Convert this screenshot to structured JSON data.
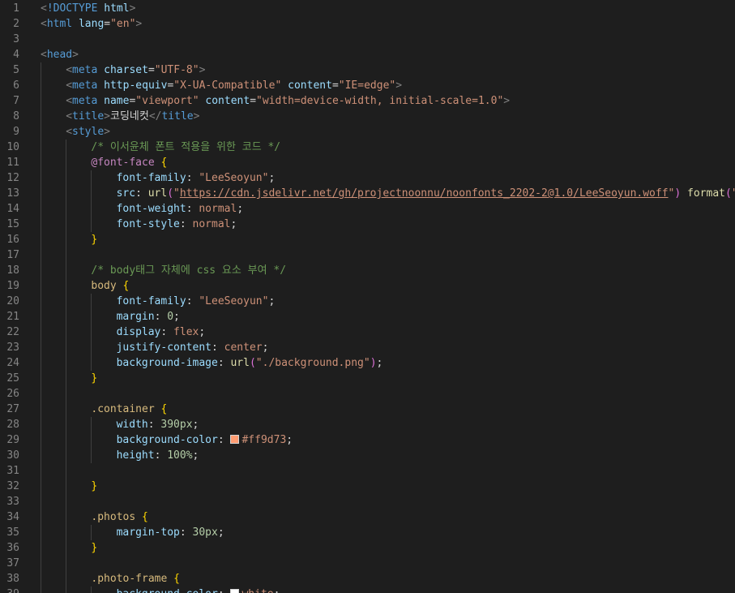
{
  "editor": {
    "lines": [
      {
        "n": "1",
        "indent": 0,
        "tokens": [
          [
            "br",
            "<"
          ],
          [
            "tag",
            "!DOCTYPE"
          ],
          [
            "txt",
            " "
          ],
          [
            "attr",
            "html"
          ],
          [
            "br",
            ">"
          ]
        ]
      },
      {
        "n": "2",
        "indent": 0,
        "tokens": [
          [
            "br",
            "<"
          ],
          [
            "tag",
            "html"
          ],
          [
            "txt",
            " "
          ],
          [
            "attr",
            "lang"
          ],
          [
            "txt",
            "="
          ],
          [
            "str",
            "\"en\""
          ],
          [
            "br",
            ">"
          ]
        ]
      },
      {
        "n": "3",
        "indent": 0,
        "tokens": []
      },
      {
        "n": "4",
        "indent": 0,
        "tokens": [
          [
            "br",
            "<"
          ],
          [
            "tag",
            "head"
          ],
          [
            "br",
            ">"
          ]
        ]
      },
      {
        "n": "5",
        "indent": 1,
        "tokens": [
          [
            "br",
            "<"
          ],
          [
            "tag",
            "meta"
          ],
          [
            "txt",
            " "
          ],
          [
            "attr",
            "charset"
          ],
          [
            "txt",
            "="
          ],
          [
            "str",
            "\"UTF-8\""
          ],
          [
            "br",
            ">"
          ]
        ]
      },
      {
        "n": "6",
        "indent": 1,
        "tokens": [
          [
            "br",
            "<"
          ],
          [
            "tag",
            "meta"
          ],
          [
            "txt",
            " "
          ],
          [
            "attr",
            "http-equiv"
          ],
          [
            "txt",
            "="
          ],
          [
            "str",
            "\"X-UA-Compatible\""
          ],
          [
            "txt",
            " "
          ],
          [
            "attr",
            "content"
          ],
          [
            "txt",
            "="
          ],
          [
            "str",
            "\"IE=edge\""
          ],
          [
            "br",
            ">"
          ]
        ]
      },
      {
        "n": "7",
        "indent": 1,
        "tokens": [
          [
            "br",
            "<"
          ],
          [
            "tag",
            "meta"
          ],
          [
            "txt",
            " "
          ],
          [
            "attr",
            "name"
          ],
          [
            "txt",
            "="
          ],
          [
            "str",
            "\"viewport\""
          ],
          [
            "txt",
            " "
          ],
          [
            "attr",
            "content"
          ],
          [
            "txt",
            "="
          ],
          [
            "str",
            "\"width=device-width, initial-scale=1.0\""
          ],
          [
            "br",
            ">"
          ]
        ]
      },
      {
        "n": "8",
        "indent": 1,
        "tokens": [
          [
            "br",
            "<"
          ],
          [
            "tag",
            "title"
          ],
          [
            "br",
            ">"
          ],
          [
            "txt",
            "코딩네컷"
          ],
          [
            "br",
            "</"
          ],
          [
            "tag",
            "title"
          ],
          [
            "br",
            ">"
          ]
        ]
      },
      {
        "n": "9",
        "indent": 1,
        "tokens": [
          [
            "br",
            "<"
          ],
          [
            "tag",
            "style"
          ],
          [
            "br",
            ">"
          ]
        ]
      },
      {
        "n": "10",
        "indent": 2,
        "tokens": [
          [
            "cmt",
            "/* 이서윤체 폰트 적용을 위한 코드 */"
          ]
        ]
      },
      {
        "n": "11",
        "indent": 2,
        "tokens": [
          [
            "at",
            "@font-face"
          ],
          [
            "txt",
            " "
          ],
          [
            "brace1",
            "{"
          ]
        ]
      },
      {
        "n": "12",
        "indent": 3,
        "tokens": [
          [
            "prop",
            "font-family"
          ],
          [
            "txt",
            ": "
          ],
          [
            "str",
            "\"LeeSeoyun\""
          ],
          [
            "txt",
            ";"
          ]
        ]
      },
      {
        "n": "13",
        "indent": 3,
        "tokens": [
          [
            "prop",
            "src"
          ],
          [
            "txt",
            ": "
          ],
          [
            "fn",
            "url"
          ],
          [
            "brace2",
            "("
          ],
          [
            "str",
            "\""
          ],
          [
            "url",
            "https://cdn.jsdelivr.net/gh/projectnoonnu/noonfonts_2202-2@1.0/LeeSeoyun.woff"
          ],
          [
            "str",
            "\""
          ],
          [
            "brace2",
            ")"
          ],
          [
            "txt",
            " "
          ],
          [
            "fn",
            "format"
          ],
          [
            "brace2",
            "("
          ],
          [
            "str",
            "\"woff\""
          ],
          [
            "brace2",
            ")"
          ],
          [
            "txt",
            ";"
          ]
        ]
      },
      {
        "n": "14",
        "indent": 3,
        "tokens": [
          [
            "prop",
            "font-weight"
          ],
          [
            "txt",
            ": "
          ],
          [
            "str",
            "normal"
          ],
          [
            "txt",
            ";"
          ]
        ]
      },
      {
        "n": "15",
        "indent": 3,
        "tokens": [
          [
            "prop",
            "font-style"
          ],
          [
            "txt",
            ": "
          ],
          [
            "str",
            "normal"
          ],
          [
            "txt",
            ";"
          ]
        ]
      },
      {
        "n": "16",
        "indent": 2,
        "tokens": [
          [
            "brace1",
            "}"
          ]
        ]
      },
      {
        "n": "17",
        "indent": 0,
        "tokens": []
      },
      {
        "n": "18",
        "indent": 2,
        "tokens": [
          [
            "cmt",
            "/* body태그 자체에 css 요소 부여 */"
          ]
        ]
      },
      {
        "n": "19",
        "indent": 2,
        "tokens": [
          [
            "sel",
            "body"
          ],
          [
            "txt",
            " "
          ],
          [
            "brace1",
            "{"
          ]
        ]
      },
      {
        "n": "20",
        "indent": 3,
        "tokens": [
          [
            "prop",
            "font-family"
          ],
          [
            "txt",
            ": "
          ],
          [
            "str",
            "\"LeeSeoyun\""
          ],
          [
            "txt",
            ";"
          ]
        ]
      },
      {
        "n": "21",
        "indent": 3,
        "tokens": [
          [
            "prop",
            "margin"
          ],
          [
            "txt",
            ": "
          ],
          [
            "num",
            "0"
          ],
          [
            "txt",
            ";"
          ]
        ]
      },
      {
        "n": "22",
        "indent": 3,
        "tokens": [
          [
            "prop",
            "display"
          ],
          [
            "txt",
            ": "
          ],
          [
            "str",
            "flex"
          ],
          [
            "txt",
            ";"
          ]
        ]
      },
      {
        "n": "23",
        "indent": 3,
        "tokens": [
          [
            "prop",
            "justify-content"
          ],
          [
            "txt",
            ": "
          ],
          [
            "str",
            "center"
          ],
          [
            "txt",
            ";"
          ]
        ]
      },
      {
        "n": "24",
        "indent": 3,
        "tokens": [
          [
            "prop",
            "background-image"
          ],
          [
            "txt",
            ": "
          ],
          [
            "fn",
            "url"
          ],
          [
            "brace2",
            "("
          ],
          [
            "str",
            "\"./background.png\""
          ],
          [
            "brace2",
            ")"
          ],
          [
            "txt",
            ";"
          ]
        ]
      },
      {
        "n": "25",
        "indent": 2,
        "tokens": [
          [
            "brace1",
            "}"
          ]
        ]
      },
      {
        "n": "26",
        "indent": 0,
        "tokens": []
      },
      {
        "n": "27",
        "indent": 2,
        "tokens": [
          [
            "sel",
            ".container"
          ],
          [
            "txt",
            " "
          ],
          [
            "brace1",
            "{"
          ]
        ]
      },
      {
        "n": "28",
        "indent": 3,
        "tokens": [
          [
            "prop",
            "width"
          ],
          [
            "txt",
            ": "
          ],
          [
            "num",
            "390px"
          ],
          [
            "txt",
            ";"
          ]
        ]
      },
      {
        "n": "29",
        "indent": 3,
        "tokens": [
          [
            "prop",
            "background-color"
          ],
          [
            "txt",
            ": "
          ],
          [
            "swatch",
            "#ff9d73"
          ],
          [
            "str",
            "#ff9d73"
          ],
          [
            "txt",
            ";"
          ]
        ]
      },
      {
        "n": "30",
        "indent": 3,
        "tokens": [
          [
            "prop",
            "height"
          ],
          [
            "txt",
            ": "
          ],
          [
            "num",
            "100%"
          ],
          [
            "txt",
            ";"
          ]
        ]
      },
      {
        "n": "31",
        "indent": 0,
        "tokens": []
      },
      {
        "n": "32",
        "indent": 2,
        "tokens": [
          [
            "brace1",
            "}"
          ]
        ]
      },
      {
        "n": "33",
        "indent": 0,
        "tokens": []
      },
      {
        "n": "34",
        "indent": 2,
        "tokens": [
          [
            "sel",
            ".photos"
          ],
          [
            "txt",
            " "
          ],
          [
            "brace1",
            "{"
          ]
        ]
      },
      {
        "n": "35",
        "indent": 3,
        "tokens": [
          [
            "prop",
            "margin-top"
          ],
          [
            "txt",
            ": "
          ],
          [
            "num",
            "30px"
          ],
          [
            "txt",
            ";"
          ]
        ]
      },
      {
        "n": "36",
        "indent": 2,
        "tokens": [
          [
            "brace1",
            "}"
          ]
        ]
      },
      {
        "n": "37",
        "indent": 0,
        "tokens": []
      },
      {
        "n": "38",
        "indent": 2,
        "tokens": [
          [
            "sel",
            ".photo-frame"
          ],
          [
            "txt",
            " "
          ],
          [
            "brace1",
            "{"
          ]
        ]
      },
      {
        "n": "39",
        "indent": 3,
        "tokens": [
          [
            "prop",
            "background-color"
          ],
          [
            "txt",
            ": "
          ],
          [
            "swatch",
            "#ffffff"
          ],
          [
            "str",
            "white"
          ],
          [
            "txt",
            ";"
          ]
        ]
      }
    ]
  }
}
